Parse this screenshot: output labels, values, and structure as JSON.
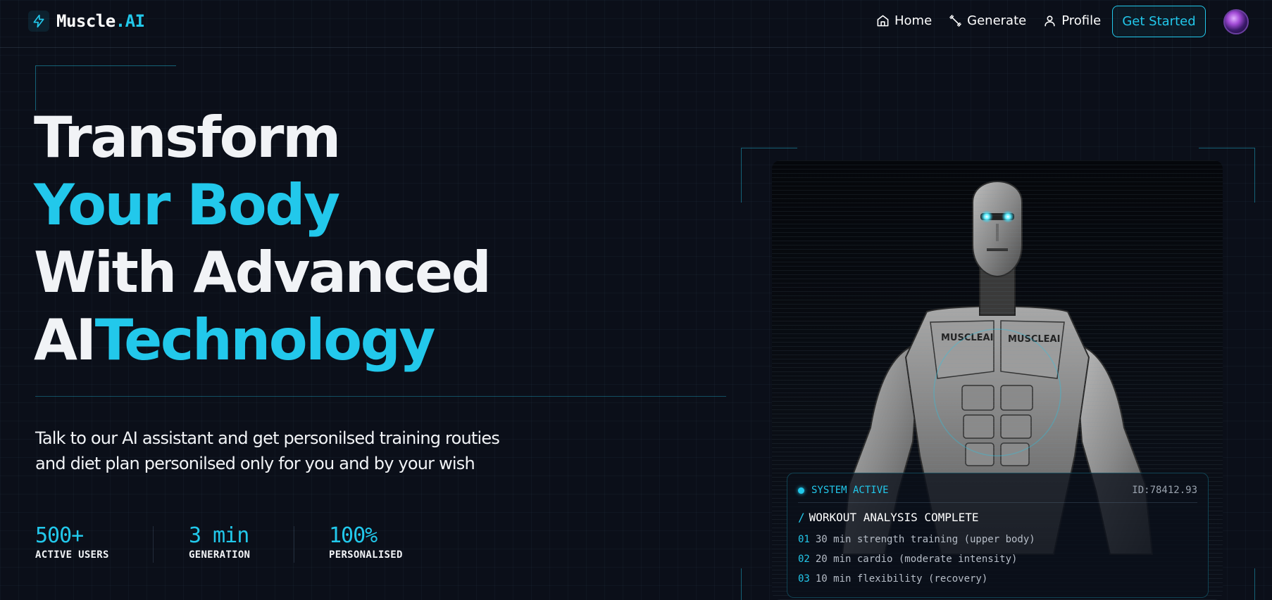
{
  "brand": {
    "name": "Muscle",
    "suffix": ".AI",
    "icon": "lightning-bolt-icon"
  },
  "nav": {
    "items": [
      {
        "label": "Home",
        "icon": "home-icon"
      },
      {
        "label": "Generate",
        "icon": "dumbbell-icon"
      },
      {
        "label": "Profile",
        "icon": "user-icon"
      }
    ],
    "cta": "Get Started",
    "avatar": "user-avatar"
  },
  "hero": {
    "line1": "Transform",
    "line2": "Your Body",
    "line3": "With Advanced",
    "line4_a": "AI",
    "line4_b": "Technology",
    "subtitle": "Talk to our AI assistant and get personilsed training routies and diet plan personilsed only for you and by your wish"
  },
  "stats": [
    {
      "value": "500+",
      "label": "ACTIVE USERS"
    },
    {
      "value": "3 min",
      "label": "GENERATION"
    },
    {
      "value": "100%",
      "label": "PERSONALISED"
    }
  ],
  "robot_image": {
    "chest_text": "MUSCLEAI"
  },
  "status_card": {
    "status": "SYSTEM ACTIVE",
    "id": "ID:78412.93",
    "title": "WORKOUT ANALYSIS COMPLETE",
    "items": [
      {
        "num": "01",
        "text": "30 min strength training (upper body)"
      },
      {
        "num": "02",
        "text": "20 min cardio (moderate intensity)"
      },
      {
        "num": "03",
        "text": "10 min flexibility (recovery)"
      }
    ]
  },
  "colors": {
    "background": "#0b0f19",
    "accent": "#22c8eb",
    "text": "#f1f3f6"
  }
}
